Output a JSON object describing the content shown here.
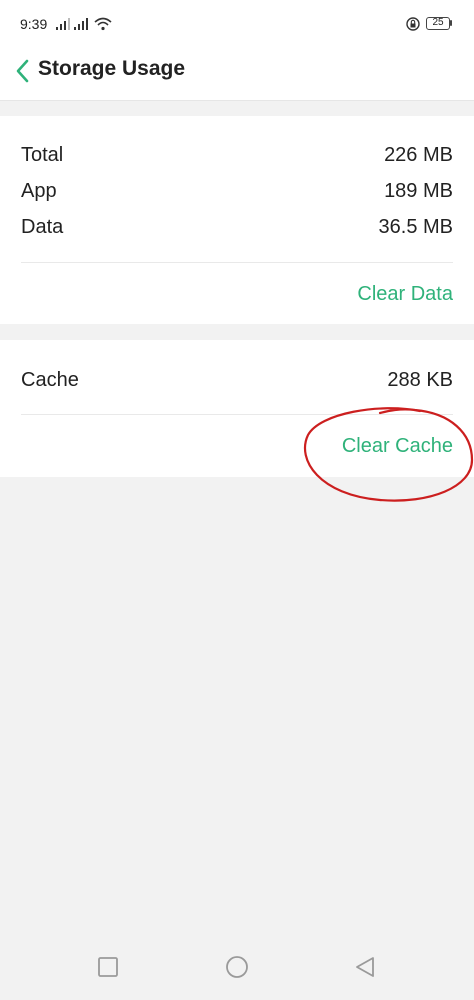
{
  "status": {
    "time": "9:39",
    "battery": "25"
  },
  "header": {
    "title": "Storage Usage"
  },
  "storage": {
    "rows": [
      {
        "label": "Total",
        "value": "226 MB"
      },
      {
        "label": "App",
        "value": "189 MB"
      },
      {
        "label": "Data",
        "value": "36.5 MB"
      }
    ],
    "clear_data_label": "Clear Data"
  },
  "cache": {
    "label": "Cache",
    "value": "288 KB",
    "clear_cache_label": "Clear Cache"
  },
  "colors": {
    "accent": "#2fb27a",
    "annotation": "#cc1f1f"
  },
  "icons": {
    "back": "chevron-left-icon",
    "recents": "square-icon",
    "home": "circle-icon",
    "nav_back": "triangle-left-icon"
  }
}
